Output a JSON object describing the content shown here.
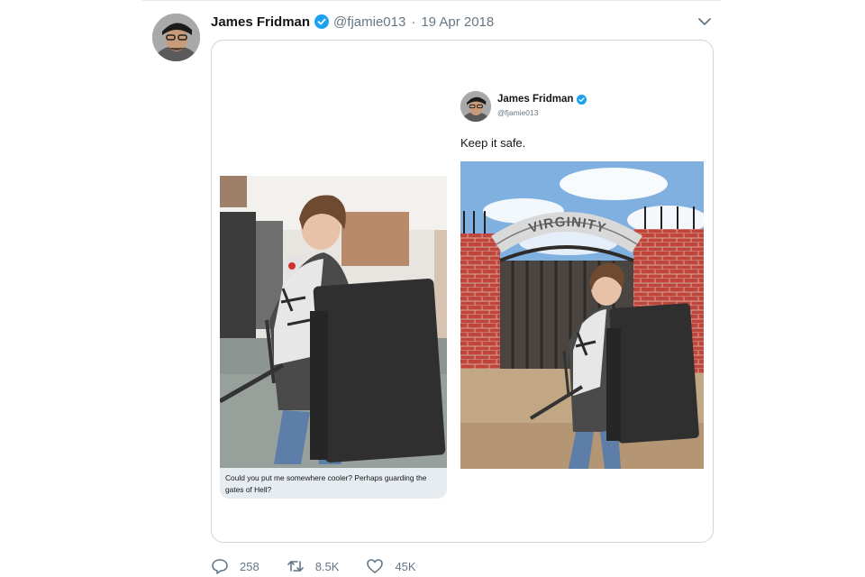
{
  "tweet": {
    "author_name": "James Fridman",
    "handle": "@fjamie013",
    "separator": "·",
    "date": "19 Apr 2018",
    "verified_icon": "verified-badge-icon",
    "menu_icon": "chevron-down-icon"
  },
  "media": {
    "dm_message": "Could you put me somewhere cooler? Perhaps guarding the gates of Hell?",
    "inner_tweet": {
      "author_name": "James Fridman",
      "handle": "@fjamie013",
      "text": "Keep it safe."
    },
    "gate_sign": "VIRGINITY"
  },
  "actions": {
    "reply_count": "258",
    "retweet_count": "8.5K",
    "like_count": "45K"
  },
  "colors": {
    "accent_blue": "#1da1f2",
    "muted_text": "#657786",
    "border": "#ccd6dd"
  }
}
